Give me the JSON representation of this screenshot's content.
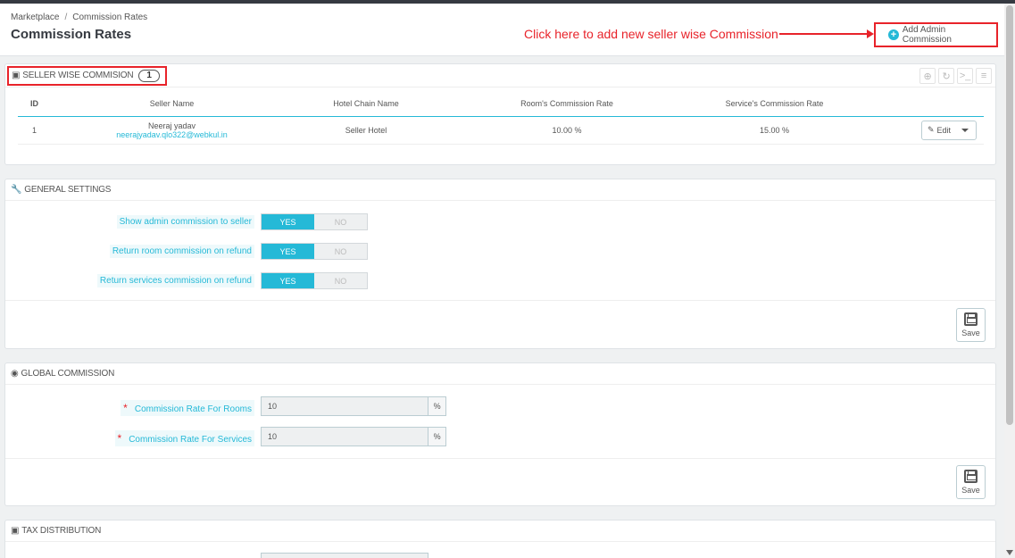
{
  "breadcrumb": {
    "parent": "Marketplace",
    "current": "Commission Rates"
  },
  "page_title": "Commission Rates",
  "annotation": "Click here to add new seller wise Commission",
  "add_button_label": "Add Admin Commission",
  "seller_panel": {
    "title": "SELLER WISE COMMISION",
    "count": "1",
    "columns": [
      "ID",
      "Seller Name",
      "Hotel Chain Name",
      "Room's Commission Rate",
      "Service's Commission Rate"
    ],
    "rows": [
      {
        "id": "1",
        "seller_name": "Neeraj yadav",
        "seller_email": "neerajyadav.qlo322@webkul.in",
        "hotel_chain": "Seller Hotel",
        "room_rate": "10.00 %",
        "service_rate": "15.00 %",
        "action": "Edit"
      }
    ]
  },
  "general_panel": {
    "title": "GENERAL SETTINGS",
    "settings": [
      {
        "label": "Show admin commission to seller",
        "yes": "YES",
        "no": "NO",
        "value": "YES"
      },
      {
        "label": "Return room commission on refund",
        "yes": "YES",
        "no": "NO",
        "value": "YES"
      },
      {
        "label": "Return services commission on refund",
        "yes": "YES",
        "no": "NO",
        "value": "YES"
      }
    ],
    "save_label": "Save"
  },
  "global_panel": {
    "title": "GLOBAL COMMISSION",
    "fields": [
      {
        "label": "Commission Rate For Rooms",
        "value": "10",
        "unit": "%"
      },
      {
        "label": "Commission Rate For Services",
        "value": "10",
        "unit": "%"
      }
    ],
    "save_label": "Save"
  },
  "tax_panel": {
    "title": "TAX DISTRIBUTION"
  },
  "colors": {
    "accent": "#25b9d7",
    "annotation": "#e8232a"
  }
}
